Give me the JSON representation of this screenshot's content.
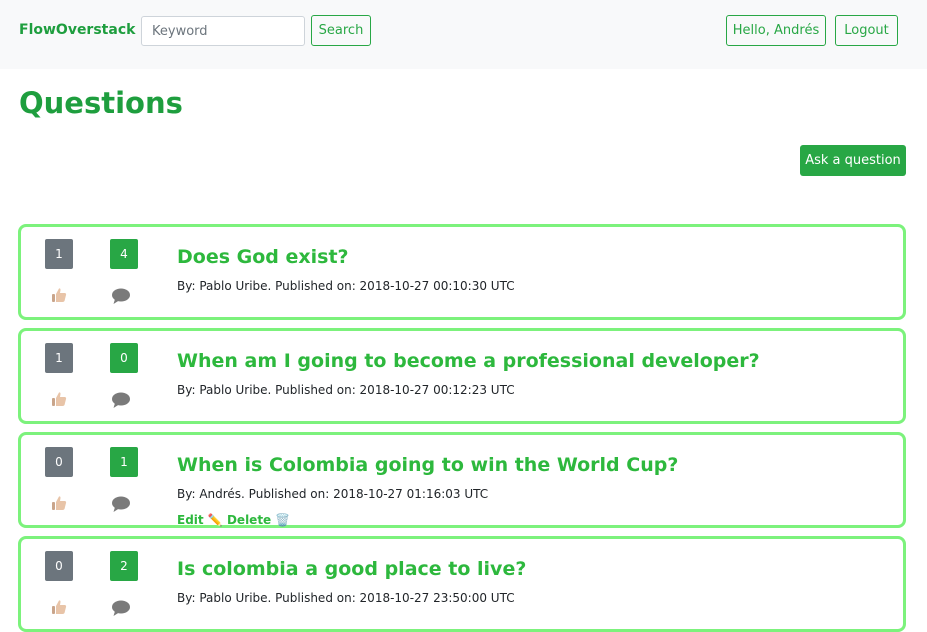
{
  "navbar": {
    "brand": "FlowOverstack",
    "search_placeholder": "Keyword",
    "search_label": "Search",
    "user_label": "Hello, Andrés",
    "logout_label": "Logout"
  },
  "page": {
    "title": "Questions",
    "ask_label": "Ask a question"
  },
  "questions": [
    {
      "likes": "1",
      "comments": "4",
      "title": "Does God exist?",
      "meta": "By: Pablo Uribe. Published on: 2018-10-27 00:10:30 UTC"
    },
    {
      "likes": "1",
      "comments": "0",
      "title": "When am I going to become a professional developer?",
      "meta": "By: Pablo Uribe. Published on: 2018-10-27 00:12:23 UTC"
    },
    {
      "likes": "0",
      "comments": "1",
      "title": "When is Colombia going to win the World Cup?",
      "meta": "By: Andrés. Published on: 2018-10-27 01:16:03 UTC",
      "edit_label": "Edit",
      "edit_emoji": "✏️",
      "delete_label": "Delete",
      "delete_emoji": "🗑️"
    },
    {
      "likes": "0",
      "comments": "2",
      "title": "Is colombia a good place to live?",
      "meta": "By: Pablo Uribe. Published on: 2018-10-27 23:50:00 UTC"
    }
  ],
  "colors": {
    "accent": "#28a745",
    "title_green": "#2db83d",
    "card_border": "#7cf27c",
    "badge_gray": "#6c757d"
  },
  "icons": {
    "like": "thumbs-up-icon",
    "comment": "speech-bubble-icon",
    "edit": "pencil-icon",
    "delete": "wastebasket-icon"
  }
}
